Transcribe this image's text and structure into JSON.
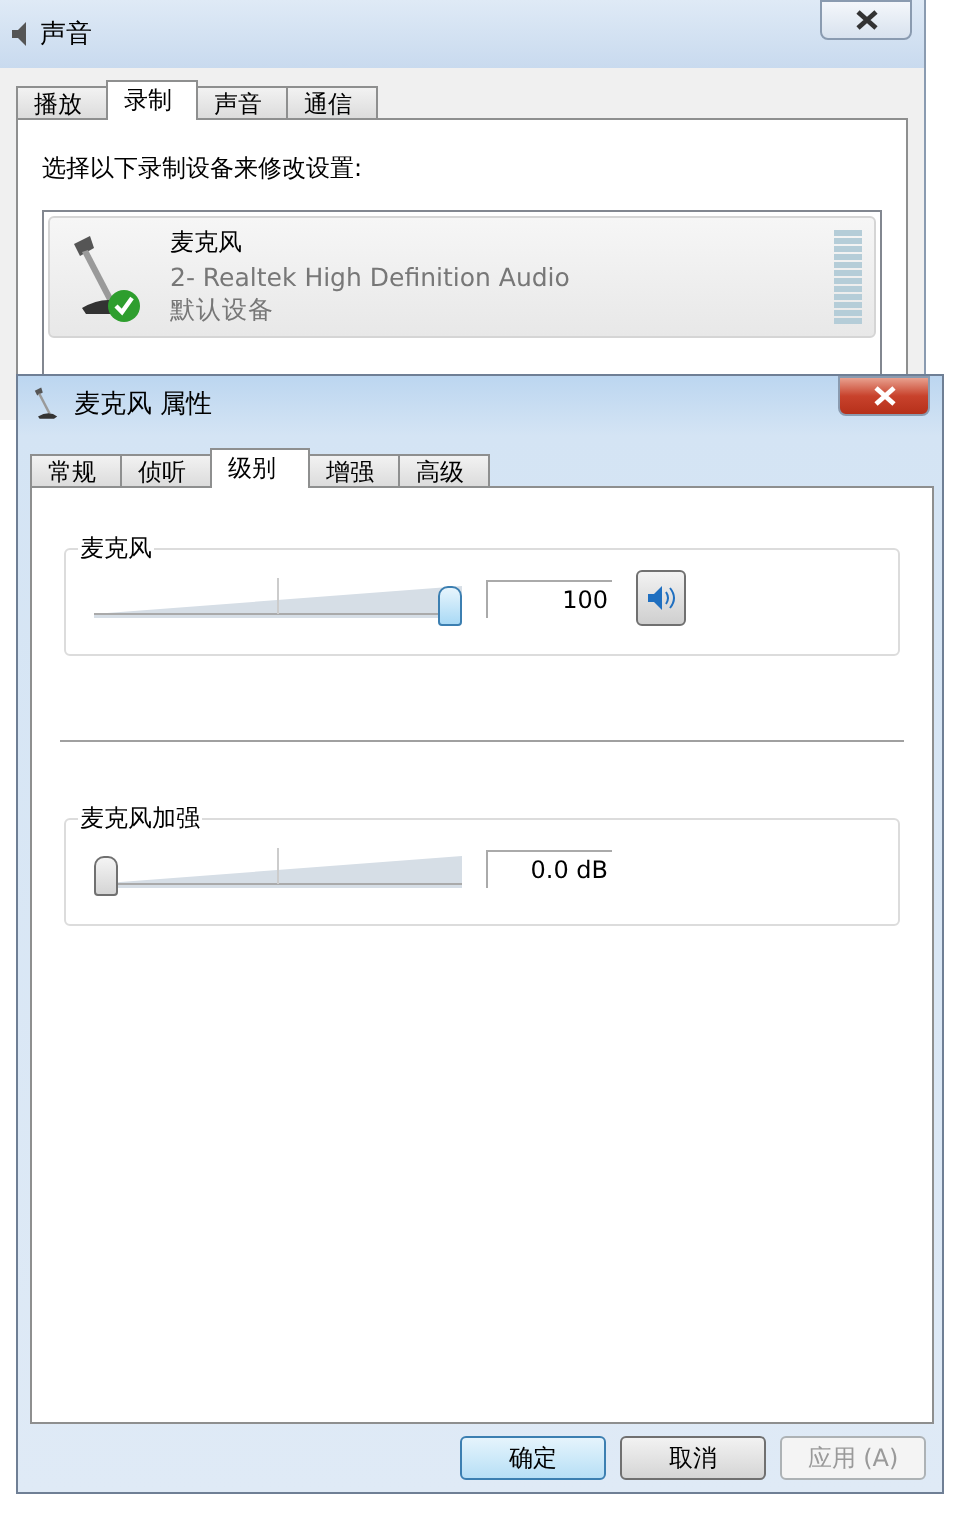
{
  "sound_window": {
    "title": "声音",
    "tabs": [
      {
        "label": "播放",
        "selected": false
      },
      {
        "label": "录制",
        "selected": true
      },
      {
        "label": "声音",
        "selected": false
      },
      {
        "label": "通信",
        "selected": false
      }
    ],
    "instruction": "选择以下录制设备来修改设置:",
    "devices": [
      {
        "name": "麦克风",
        "driver": "2- Realtek High Definition Audio",
        "status": "默认设备",
        "default": true
      }
    ]
  },
  "properties_dialog": {
    "title": "麦克风 属性",
    "tabs": [
      {
        "label": "常规",
        "selected": false
      },
      {
        "label": "侦听",
        "selected": false
      },
      {
        "label": "级别",
        "selected": true
      },
      {
        "label": "增强",
        "selected": false
      },
      {
        "label": "高级",
        "selected": false
      }
    ],
    "levels": [
      {
        "label": "麦克风",
        "level": 1,
        "reading": "100",
        "mute_button": true
      },
      {
        "label": "麦克风加强",
        "level": 0,
        "reading": "0.0 dB",
        "mute_button": false
      }
    ],
    "buttons": [
      {
        "label": "确定",
        "kind": "default",
        "disabled": false
      },
      {
        "label": "取消",
        "kind": "normal",
        "disabled": false
      },
      {
        "label": "应用 (A)",
        "kind": "normal",
        "disabled": true
      }
    ]
  }
}
